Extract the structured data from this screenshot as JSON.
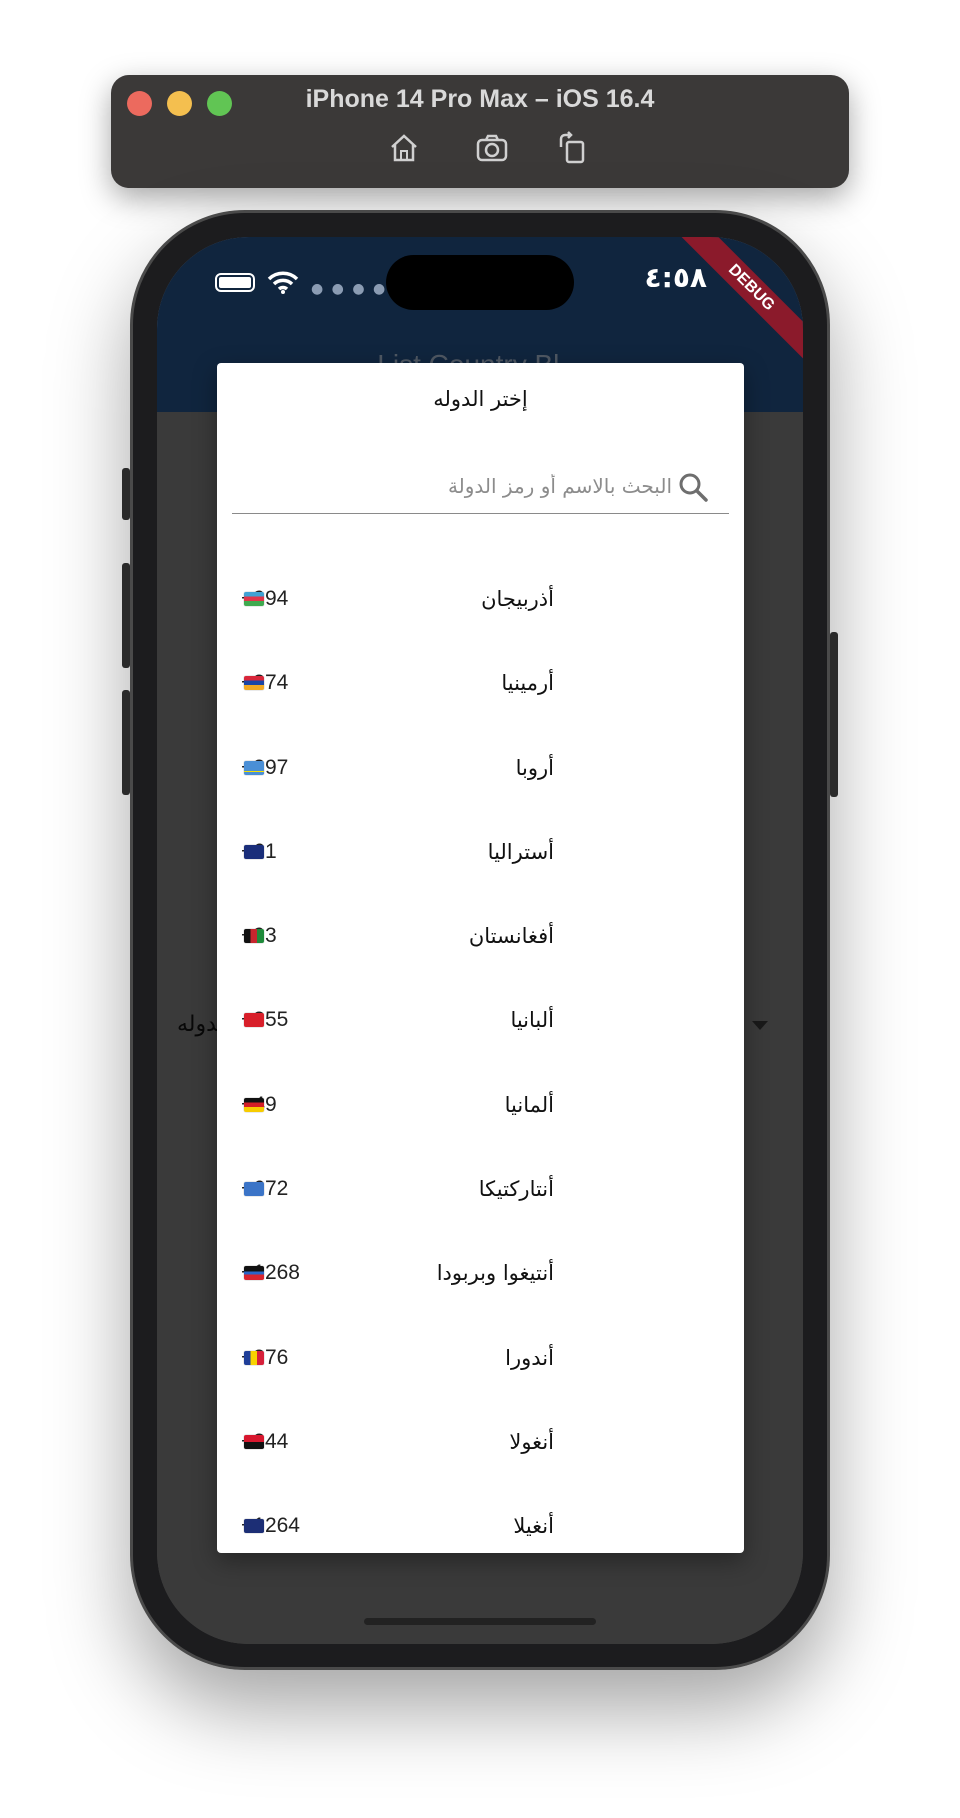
{
  "simulator": {
    "title": "iPhone 14 Pro Max – iOS 16.4",
    "toolbar_icons": [
      "home-icon",
      "screenshot-icon",
      "rotate-icon"
    ]
  },
  "status_bar": {
    "time": "٤:٥٨",
    "debug_label": "DEBUG"
  },
  "app_bar": {
    "title": "List Country Bl..."
  },
  "background": {
    "dropdown_label": "الدوله"
  },
  "dialog": {
    "title": "إختر الدوله",
    "search": {
      "placeholder": "البحث بالاسم أو رمز الدولة",
      "value": ""
    },
    "countries": [
      {
        "name": "أذربيجان",
        "code": "+994",
        "flag": "az-flag"
      },
      {
        "name": "أرمينيا",
        "code": "+374",
        "flag": "am-flag"
      },
      {
        "name": "أروبا",
        "code": "+297",
        "flag": "aw-flag"
      },
      {
        "name": "أستراليا",
        "code": "+61",
        "flag": "au-flag"
      },
      {
        "name": "أفغانستان",
        "code": "+93",
        "flag": "af-flag"
      },
      {
        "name": "ألبانيا",
        "code": "+355",
        "flag": "al-flag"
      },
      {
        "name": "ألمانيا",
        "code": "+49",
        "flag": "de-flag"
      },
      {
        "name": "أنتاركتيكا",
        "code": "+672",
        "flag": "aq-flag"
      },
      {
        "name": "أنتيغوا وبربودا",
        "code": "+1268",
        "flag": "ag-flag"
      },
      {
        "name": "أندورا",
        "code": "+376",
        "flag": "ad-flag"
      },
      {
        "name": "أنغولا",
        "code": "+244",
        "flag": "ao-flag"
      },
      {
        "name": "أنغيلا",
        "code": "+1264",
        "flag": "ai-flag"
      }
    ]
  },
  "colors": {
    "app_bar": "#214a7d",
    "debug_ribbon": "#8b1a2b",
    "scrim": "#747474"
  }
}
